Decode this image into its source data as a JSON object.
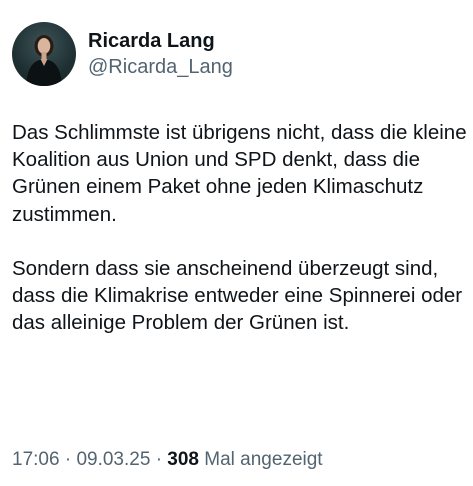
{
  "author": {
    "display_name": "Ricarda Lang",
    "handle": "@Ricarda_Lang"
  },
  "tweet": {
    "paragraph_1": "Das Schlimmste ist übrigens nicht, dass die kleine Koalition aus Union und SPD denkt, dass die Grünen einem Paket ohne jeden Klimaschutz zustimmen.",
    "paragraph_2": "Sondern dass sie anscheinend überzeugt sind, dass die Klimakrise entweder eine Spinnerei oder das alleinige Problem der Grünen ist."
  },
  "meta": {
    "time": "17:06",
    "separator": "·",
    "date": "09.03.25",
    "views_count": "308",
    "views_label": "Mal angezeigt"
  },
  "colors": {
    "text_primary": "#0f1419",
    "text_secondary": "#536471",
    "background": "#ffffff"
  }
}
